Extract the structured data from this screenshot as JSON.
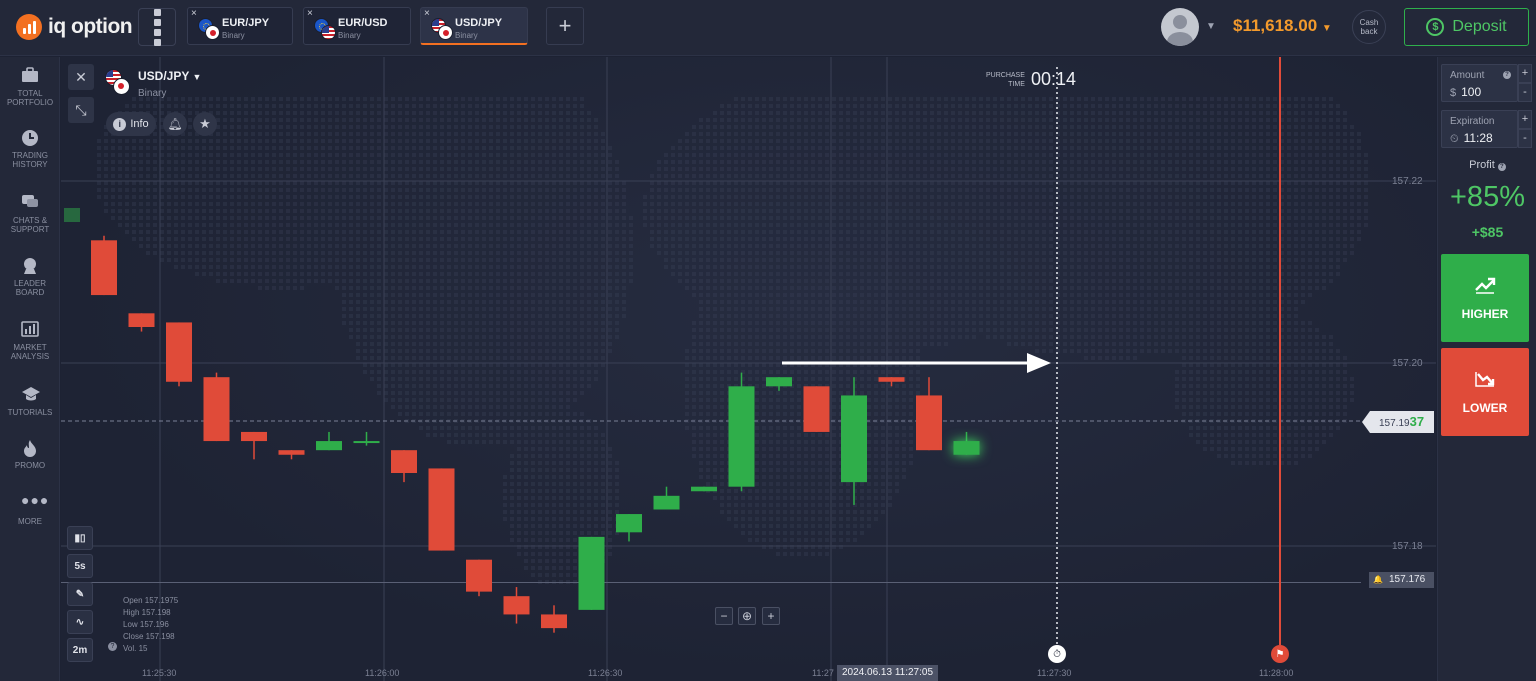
{
  "brand": {
    "name": "iq option",
    "accent": "#f37021"
  },
  "tabs": [
    {
      "pair": "EUR/JPY",
      "type": "Binary",
      "close": "×",
      "flags": [
        "eu",
        "jp"
      ],
      "active": false
    },
    {
      "pair": "EUR/USD",
      "type": "Binary",
      "close": "×",
      "flags": [
        "eu",
        "us"
      ],
      "active": false
    },
    {
      "pair": "USD/JPY",
      "type": "Binary",
      "close": "×",
      "flags": [
        "us",
        "jp"
      ],
      "active": true
    }
  ],
  "add_tab_label": "+",
  "account": {
    "balance": "$11,618.00",
    "cashback": "Cash back",
    "deposit_label": "Deposit",
    "deposit_icon": "$"
  },
  "sidebar": [
    {
      "label": "TOTAL PORTFOLIO",
      "icon": "briefcase-icon"
    },
    {
      "label": "TRADING HISTORY",
      "icon": "clock-icon"
    },
    {
      "label": "CHATS & SUPPORT",
      "icon": "chat-icon"
    },
    {
      "label": "LEADER BOARD",
      "icon": "medal-icon"
    },
    {
      "label": "MARKET ANALYSIS",
      "icon": "analysis-icon"
    },
    {
      "label": "TUTORIALS",
      "icon": "graduation-cap-icon"
    },
    {
      "label": "PROMO",
      "icon": "flame-icon"
    },
    {
      "label": "MORE",
      "icon": "more-icon"
    }
  ],
  "asset": {
    "name": "USD/JPY",
    "type": "Binary",
    "info_label": "Info"
  },
  "purchase": {
    "label_line1": "PURCHASE",
    "label_line2": "TIME",
    "countdown": "00:14"
  },
  "chart": {
    "current_price_main": "157.19",
    "current_price_tail": "37",
    "alert_price": "157.176",
    "y_ticks": [
      "157.22",
      "157.20",
      "157.18"
    ],
    "x_ticks": [
      "11:25:30",
      "11:26:00",
      "11:26:30",
      "11:27",
      "11:27:30",
      "11:28:00"
    ],
    "crosshair_time": "2024.06.13 11:27:05",
    "ohlc": {
      "open": "Open 157.1975",
      "high": "High 157.198",
      "low": "Low 157.196",
      "close": "Close 157.198",
      "vol": "Vol. 15"
    },
    "tools": [
      "chart-type",
      "5s",
      "draw",
      "indicators",
      "2m"
    ],
    "tool_labels": {
      "interval": "5s",
      "timeframe": "2m"
    },
    "colors": {
      "up": "#2fae4a",
      "down": "#e04b39"
    }
  },
  "chart_data": {
    "type": "candlestick",
    "ylim": [
      157.171,
      157.2245
    ],
    "candles": [
      {
        "o": 157.2135,
        "h": 157.214,
        "l": 157.2075,
        "c": 157.2075
      },
      {
        "o": 157.2055,
        "h": 157.2055,
        "l": 157.2035,
        "c": 157.204
      },
      {
        "o": 157.2045,
        "h": 157.2045,
        "l": 157.1975,
        "c": 157.198
      },
      {
        "o": 157.1985,
        "h": 157.199,
        "l": 157.1915,
        "c": 157.1915
      },
      {
        "o": 157.1925,
        "h": 157.1925,
        "l": 157.1895,
        "c": 157.1915
      },
      {
        "o": 157.1905,
        "h": 157.1905,
        "l": 157.1895,
        "c": 157.19
      },
      {
        "o": 157.1905,
        "h": 157.1925,
        "l": 157.1905,
        "c": 157.1915
      },
      {
        "o": 157.1915,
        "h": 157.1925,
        "l": 157.191,
        "c": 157.1915
      },
      {
        "o": 157.1905,
        "h": 157.1905,
        "l": 157.187,
        "c": 157.188
      },
      {
        "o": 157.1885,
        "h": 157.1885,
        "l": 157.1795,
        "c": 157.1795
      },
      {
        "o": 157.1785,
        "h": 157.1785,
        "l": 157.1745,
        "c": 157.175
      },
      {
        "o": 157.1745,
        "h": 157.1755,
        "l": 157.1715,
        "c": 157.1725
      },
      {
        "o": 157.1725,
        "h": 157.1735,
        "l": 157.1705,
        "c": 157.171
      },
      {
        "o": 157.173,
        "h": 157.181,
        "l": 157.173,
        "c": 157.181
      },
      {
        "o": 157.1815,
        "h": 157.1835,
        "l": 157.1805,
        "c": 157.1835
      },
      {
        "o": 157.184,
        "h": 157.1865,
        "l": 157.184,
        "c": 157.1855
      },
      {
        "o": 157.186,
        "h": 157.1865,
        "l": 157.186,
        "c": 157.1865
      },
      {
        "o": 157.1865,
        "h": 157.199,
        "l": 157.186,
        "c": 157.1975
      },
      {
        "o": 157.1975,
        "h": 157.1985,
        "l": 157.197,
        "c": 157.1985
      },
      {
        "o": 157.1975,
        "h": 157.1975,
        "l": 157.1925,
        "c": 157.1925
      },
      {
        "o": 157.187,
        "h": 157.1985,
        "l": 157.1845,
        "c": 157.1965
      },
      {
        "o": 157.1985,
        "h": 157.1985,
        "l": 157.1975,
        "c": 157.198
      },
      {
        "o": 157.1965,
        "h": 157.1985,
        "l": 157.1905,
        "c": 157.1905
      },
      {
        "o": 157.19,
        "h": 157.1925,
        "l": 157.19,
        "c": 157.1915
      }
    ],
    "current_price": 157.1937,
    "alert_level": 157.176,
    "purchase_line_time": "11:27:30",
    "expiration_line_time": "11:28:00"
  },
  "trade": {
    "amount_label": "Amount",
    "amount_currency": "$",
    "amount_value": "100",
    "expiration_label": "Expiration",
    "expiration_value": "11:28",
    "profit_label": "Profit",
    "profit_pct": "+85%",
    "profit_amount": "+$85",
    "higher_label": "HIGHER",
    "lower_label": "LOWER",
    "help": "?",
    "plus": "+",
    "minus": "-"
  }
}
